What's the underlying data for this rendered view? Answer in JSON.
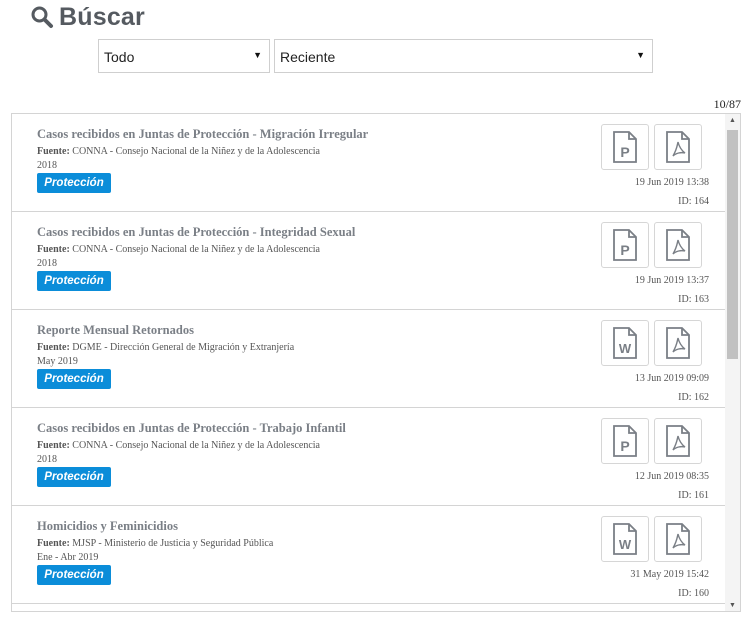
{
  "header": {
    "title": "Búscar",
    "icon": "search-icon"
  },
  "filters": {
    "type_select": "Todo",
    "order_select": "Reciente"
  },
  "results": {
    "count": "10/87",
    "items": [
      {
        "title": "Casos recibidos en Juntas de Protección - Migración Irregular",
        "source_label": "Fuente:",
        "source": "CONNA - Consejo Nacional de la Niñez y de la Adolescencia",
        "period": "2018",
        "category": "Protección",
        "date": "19 Jun 2019 13:38",
        "id": "ID: 164",
        "file_type": "ppt"
      },
      {
        "title": "Casos recibidos en Juntas de Protección - Integridad Sexual",
        "source_label": "Fuente:",
        "source": "CONNA - Consejo Nacional de la Niñez y de la Adolescencia",
        "period": "2018",
        "category": "Protección",
        "date": "19 Jun 2019 13:37",
        "id": "ID: 163",
        "file_type": "ppt"
      },
      {
        "title": "Reporte Mensual Retornados",
        "source_label": "Fuente:",
        "source": "DGME - Dirección General de Migración y Extranjería",
        "period": "May 2019",
        "category": "Protección",
        "date": "13 Jun 2019 09:09",
        "id": "ID: 162",
        "file_type": "word"
      },
      {
        "title": "Casos recibidos en Juntas de Protección - Trabajo Infantil",
        "source_label": "Fuente:",
        "source": "CONNA - Consejo Nacional de la Niñez y de la Adolescencia",
        "period": "2018",
        "category": "Protección",
        "date": "12 Jun 2019 08:35",
        "id": "ID: 161",
        "file_type": "ppt"
      },
      {
        "title": "Homicidios y Feminicidios",
        "source_label": "Fuente:",
        "source": "MJSP - Ministerio de Justicia y Seguridad Pública",
        "period": "Ene - Abr 2019",
        "category": "Protección",
        "date": "31 May 2019 15:42",
        "id": "ID: 160",
        "file_type": "word"
      }
    ]
  },
  "colors": {
    "badge": "#0b8dd9",
    "title": "#7a7f86",
    "heading": "#555a60"
  }
}
